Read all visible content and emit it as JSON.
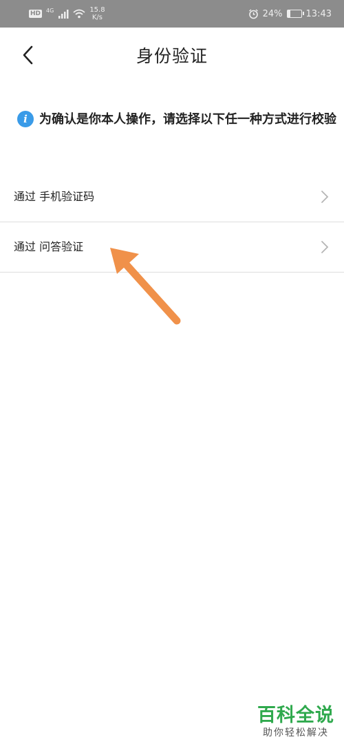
{
  "status_bar": {
    "hd": "HD",
    "network": "4G",
    "speed_value": "15.8",
    "speed_unit": "K/s",
    "battery_percent": "24%",
    "battery_level": 0.24,
    "time": "13:43"
  },
  "header": {
    "title": "身份验证",
    "back_icon": "chevron-left-icon"
  },
  "notice": {
    "icon": "info-icon",
    "icon_glyph": "i",
    "text": "为确认是你本人操作，请选择以下任一种方式进行校验"
  },
  "options": [
    {
      "label": "通过 手机验证码",
      "icon": "chevron-right-icon"
    },
    {
      "label": "通过 问答验证",
      "icon": "chevron-right-icon"
    }
  ],
  "annotation": {
    "arrow_color": "#f0914a"
  },
  "watermark": {
    "main": "百科全说",
    "sub": "助你轻松解决"
  },
  "colors": {
    "status_bar_bg": "#8c8c8c",
    "info_icon": "#3a9be8",
    "divider": "#dddddd",
    "watermark_green": "#2fa94d"
  }
}
